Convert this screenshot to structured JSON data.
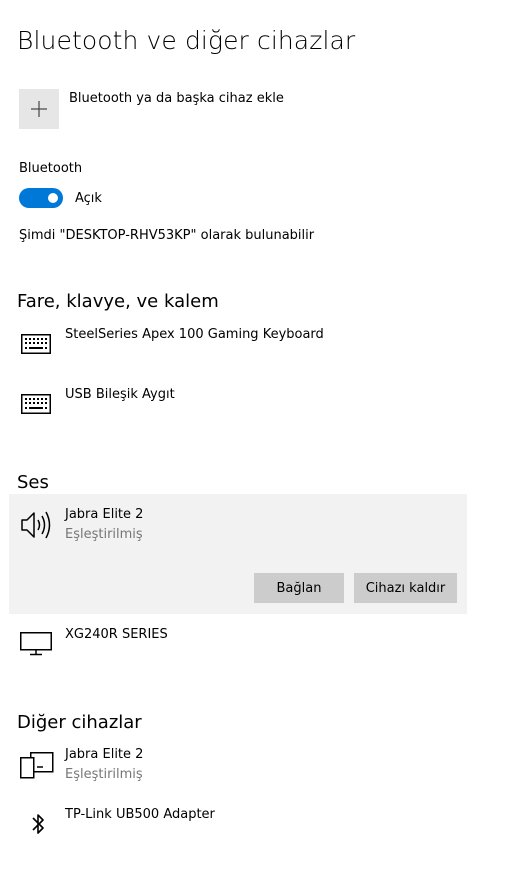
{
  "page": {
    "title": "Bluetooth ve diğer cihazlar",
    "add_device_label": "Bluetooth ya da başka cihaz ekle"
  },
  "bluetooth": {
    "label": "Bluetooth",
    "toggle_state": "Açık",
    "on": true,
    "discoverable_text": "Şimdi \"DESKTOP-RHV53KP\" olarak bulunabilir"
  },
  "sections": {
    "input": {
      "heading": "Fare, klavye, ve kalem",
      "devices": [
        {
          "name": "SteelSeries Apex 100 Gaming Keyboard",
          "icon": "keyboard-icon"
        },
        {
          "name": "USB Bileşik Aygıt",
          "icon": "keyboard-icon"
        }
      ]
    },
    "audio": {
      "heading": "Ses",
      "devices": [
        {
          "name": "Jabra Elite 2",
          "status": "Eşleştirilmiş",
          "icon": "speaker-icon",
          "selected": true
        },
        {
          "name": "XG240R SERIES",
          "icon": "monitor-icon"
        }
      ],
      "actions": {
        "connect": "Bağlan",
        "remove": "Cihazı kaldır"
      }
    },
    "other": {
      "heading": "Diğer cihazlar",
      "devices": [
        {
          "name": "Jabra Elite 2",
          "status": "Eşleştirilmiş",
          "icon": "device-icon"
        },
        {
          "name": "TP-Link UB500 Adapter",
          "icon": "bluetooth-icon"
        }
      ]
    }
  },
  "colors": {
    "accent": "#0078d7",
    "selected_background": "#f2f2f2",
    "button_background": "#cccccc",
    "secondary_text": "#767676"
  }
}
